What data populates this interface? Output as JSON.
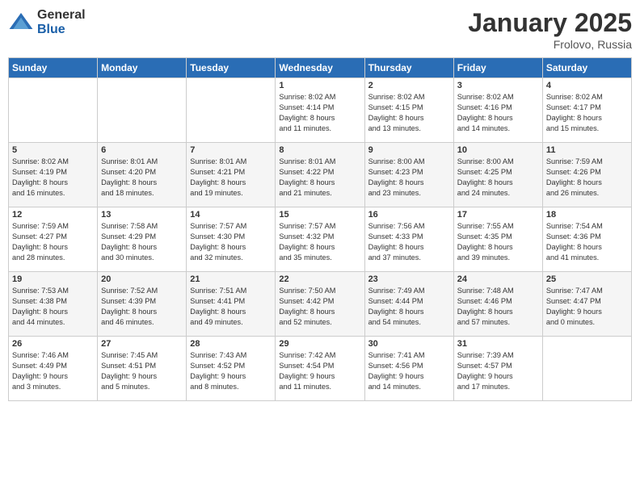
{
  "logo": {
    "general": "General",
    "blue": "Blue"
  },
  "title": "January 2025",
  "subtitle": "Frolovo, Russia",
  "days_header": [
    "Sunday",
    "Monday",
    "Tuesday",
    "Wednesday",
    "Thursday",
    "Friday",
    "Saturday"
  ],
  "weeks": [
    [
      {
        "day": "",
        "info": ""
      },
      {
        "day": "",
        "info": ""
      },
      {
        "day": "",
        "info": ""
      },
      {
        "day": "1",
        "info": "Sunrise: 8:02 AM\nSunset: 4:14 PM\nDaylight: 8 hours\nand 11 minutes."
      },
      {
        "day": "2",
        "info": "Sunrise: 8:02 AM\nSunset: 4:15 PM\nDaylight: 8 hours\nand 13 minutes."
      },
      {
        "day": "3",
        "info": "Sunrise: 8:02 AM\nSunset: 4:16 PM\nDaylight: 8 hours\nand 14 minutes."
      },
      {
        "day": "4",
        "info": "Sunrise: 8:02 AM\nSunset: 4:17 PM\nDaylight: 8 hours\nand 15 minutes."
      }
    ],
    [
      {
        "day": "5",
        "info": "Sunrise: 8:02 AM\nSunset: 4:19 PM\nDaylight: 8 hours\nand 16 minutes."
      },
      {
        "day": "6",
        "info": "Sunrise: 8:01 AM\nSunset: 4:20 PM\nDaylight: 8 hours\nand 18 minutes."
      },
      {
        "day": "7",
        "info": "Sunrise: 8:01 AM\nSunset: 4:21 PM\nDaylight: 8 hours\nand 19 minutes."
      },
      {
        "day": "8",
        "info": "Sunrise: 8:01 AM\nSunset: 4:22 PM\nDaylight: 8 hours\nand 21 minutes."
      },
      {
        "day": "9",
        "info": "Sunrise: 8:00 AM\nSunset: 4:23 PM\nDaylight: 8 hours\nand 23 minutes."
      },
      {
        "day": "10",
        "info": "Sunrise: 8:00 AM\nSunset: 4:25 PM\nDaylight: 8 hours\nand 24 minutes."
      },
      {
        "day": "11",
        "info": "Sunrise: 7:59 AM\nSunset: 4:26 PM\nDaylight: 8 hours\nand 26 minutes."
      }
    ],
    [
      {
        "day": "12",
        "info": "Sunrise: 7:59 AM\nSunset: 4:27 PM\nDaylight: 8 hours\nand 28 minutes."
      },
      {
        "day": "13",
        "info": "Sunrise: 7:58 AM\nSunset: 4:29 PM\nDaylight: 8 hours\nand 30 minutes."
      },
      {
        "day": "14",
        "info": "Sunrise: 7:57 AM\nSunset: 4:30 PM\nDaylight: 8 hours\nand 32 minutes."
      },
      {
        "day": "15",
        "info": "Sunrise: 7:57 AM\nSunset: 4:32 PM\nDaylight: 8 hours\nand 35 minutes."
      },
      {
        "day": "16",
        "info": "Sunrise: 7:56 AM\nSunset: 4:33 PM\nDaylight: 8 hours\nand 37 minutes."
      },
      {
        "day": "17",
        "info": "Sunrise: 7:55 AM\nSunset: 4:35 PM\nDaylight: 8 hours\nand 39 minutes."
      },
      {
        "day": "18",
        "info": "Sunrise: 7:54 AM\nSunset: 4:36 PM\nDaylight: 8 hours\nand 41 minutes."
      }
    ],
    [
      {
        "day": "19",
        "info": "Sunrise: 7:53 AM\nSunset: 4:38 PM\nDaylight: 8 hours\nand 44 minutes."
      },
      {
        "day": "20",
        "info": "Sunrise: 7:52 AM\nSunset: 4:39 PM\nDaylight: 8 hours\nand 46 minutes."
      },
      {
        "day": "21",
        "info": "Sunrise: 7:51 AM\nSunset: 4:41 PM\nDaylight: 8 hours\nand 49 minutes."
      },
      {
        "day": "22",
        "info": "Sunrise: 7:50 AM\nSunset: 4:42 PM\nDaylight: 8 hours\nand 52 minutes."
      },
      {
        "day": "23",
        "info": "Sunrise: 7:49 AM\nSunset: 4:44 PM\nDaylight: 8 hours\nand 54 minutes."
      },
      {
        "day": "24",
        "info": "Sunrise: 7:48 AM\nSunset: 4:46 PM\nDaylight: 8 hours\nand 57 minutes."
      },
      {
        "day": "25",
        "info": "Sunrise: 7:47 AM\nSunset: 4:47 PM\nDaylight: 9 hours\nand 0 minutes."
      }
    ],
    [
      {
        "day": "26",
        "info": "Sunrise: 7:46 AM\nSunset: 4:49 PM\nDaylight: 9 hours\nand 3 minutes."
      },
      {
        "day": "27",
        "info": "Sunrise: 7:45 AM\nSunset: 4:51 PM\nDaylight: 9 hours\nand 5 minutes."
      },
      {
        "day": "28",
        "info": "Sunrise: 7:43 AM\nSunset: 4:52 PM\nDaylight: 9 hours\nand 8 minutes."
      },
      {
        "day": "29",
        "info": "Sunrise: 7:42 AM\nSunset: 4:54 PM\nDaylight: 9 hours\nand 11 minutes."
      },
      {
        "day": "30",
        "info": "Sunrise: 7:41 AM\nSunset: 4:56 PM\nDaylight: 9 hours\nand 14 minutes."
      },
      {
        "day": "31",
        "info": "Sunrise: 7:39 AM\nSunset: 4:57 PM\nDaylight: 9 hours\nand 17 minutes."
      },
      {
        "day": "",
        "info": ""
      }
    ]
  ]
}
